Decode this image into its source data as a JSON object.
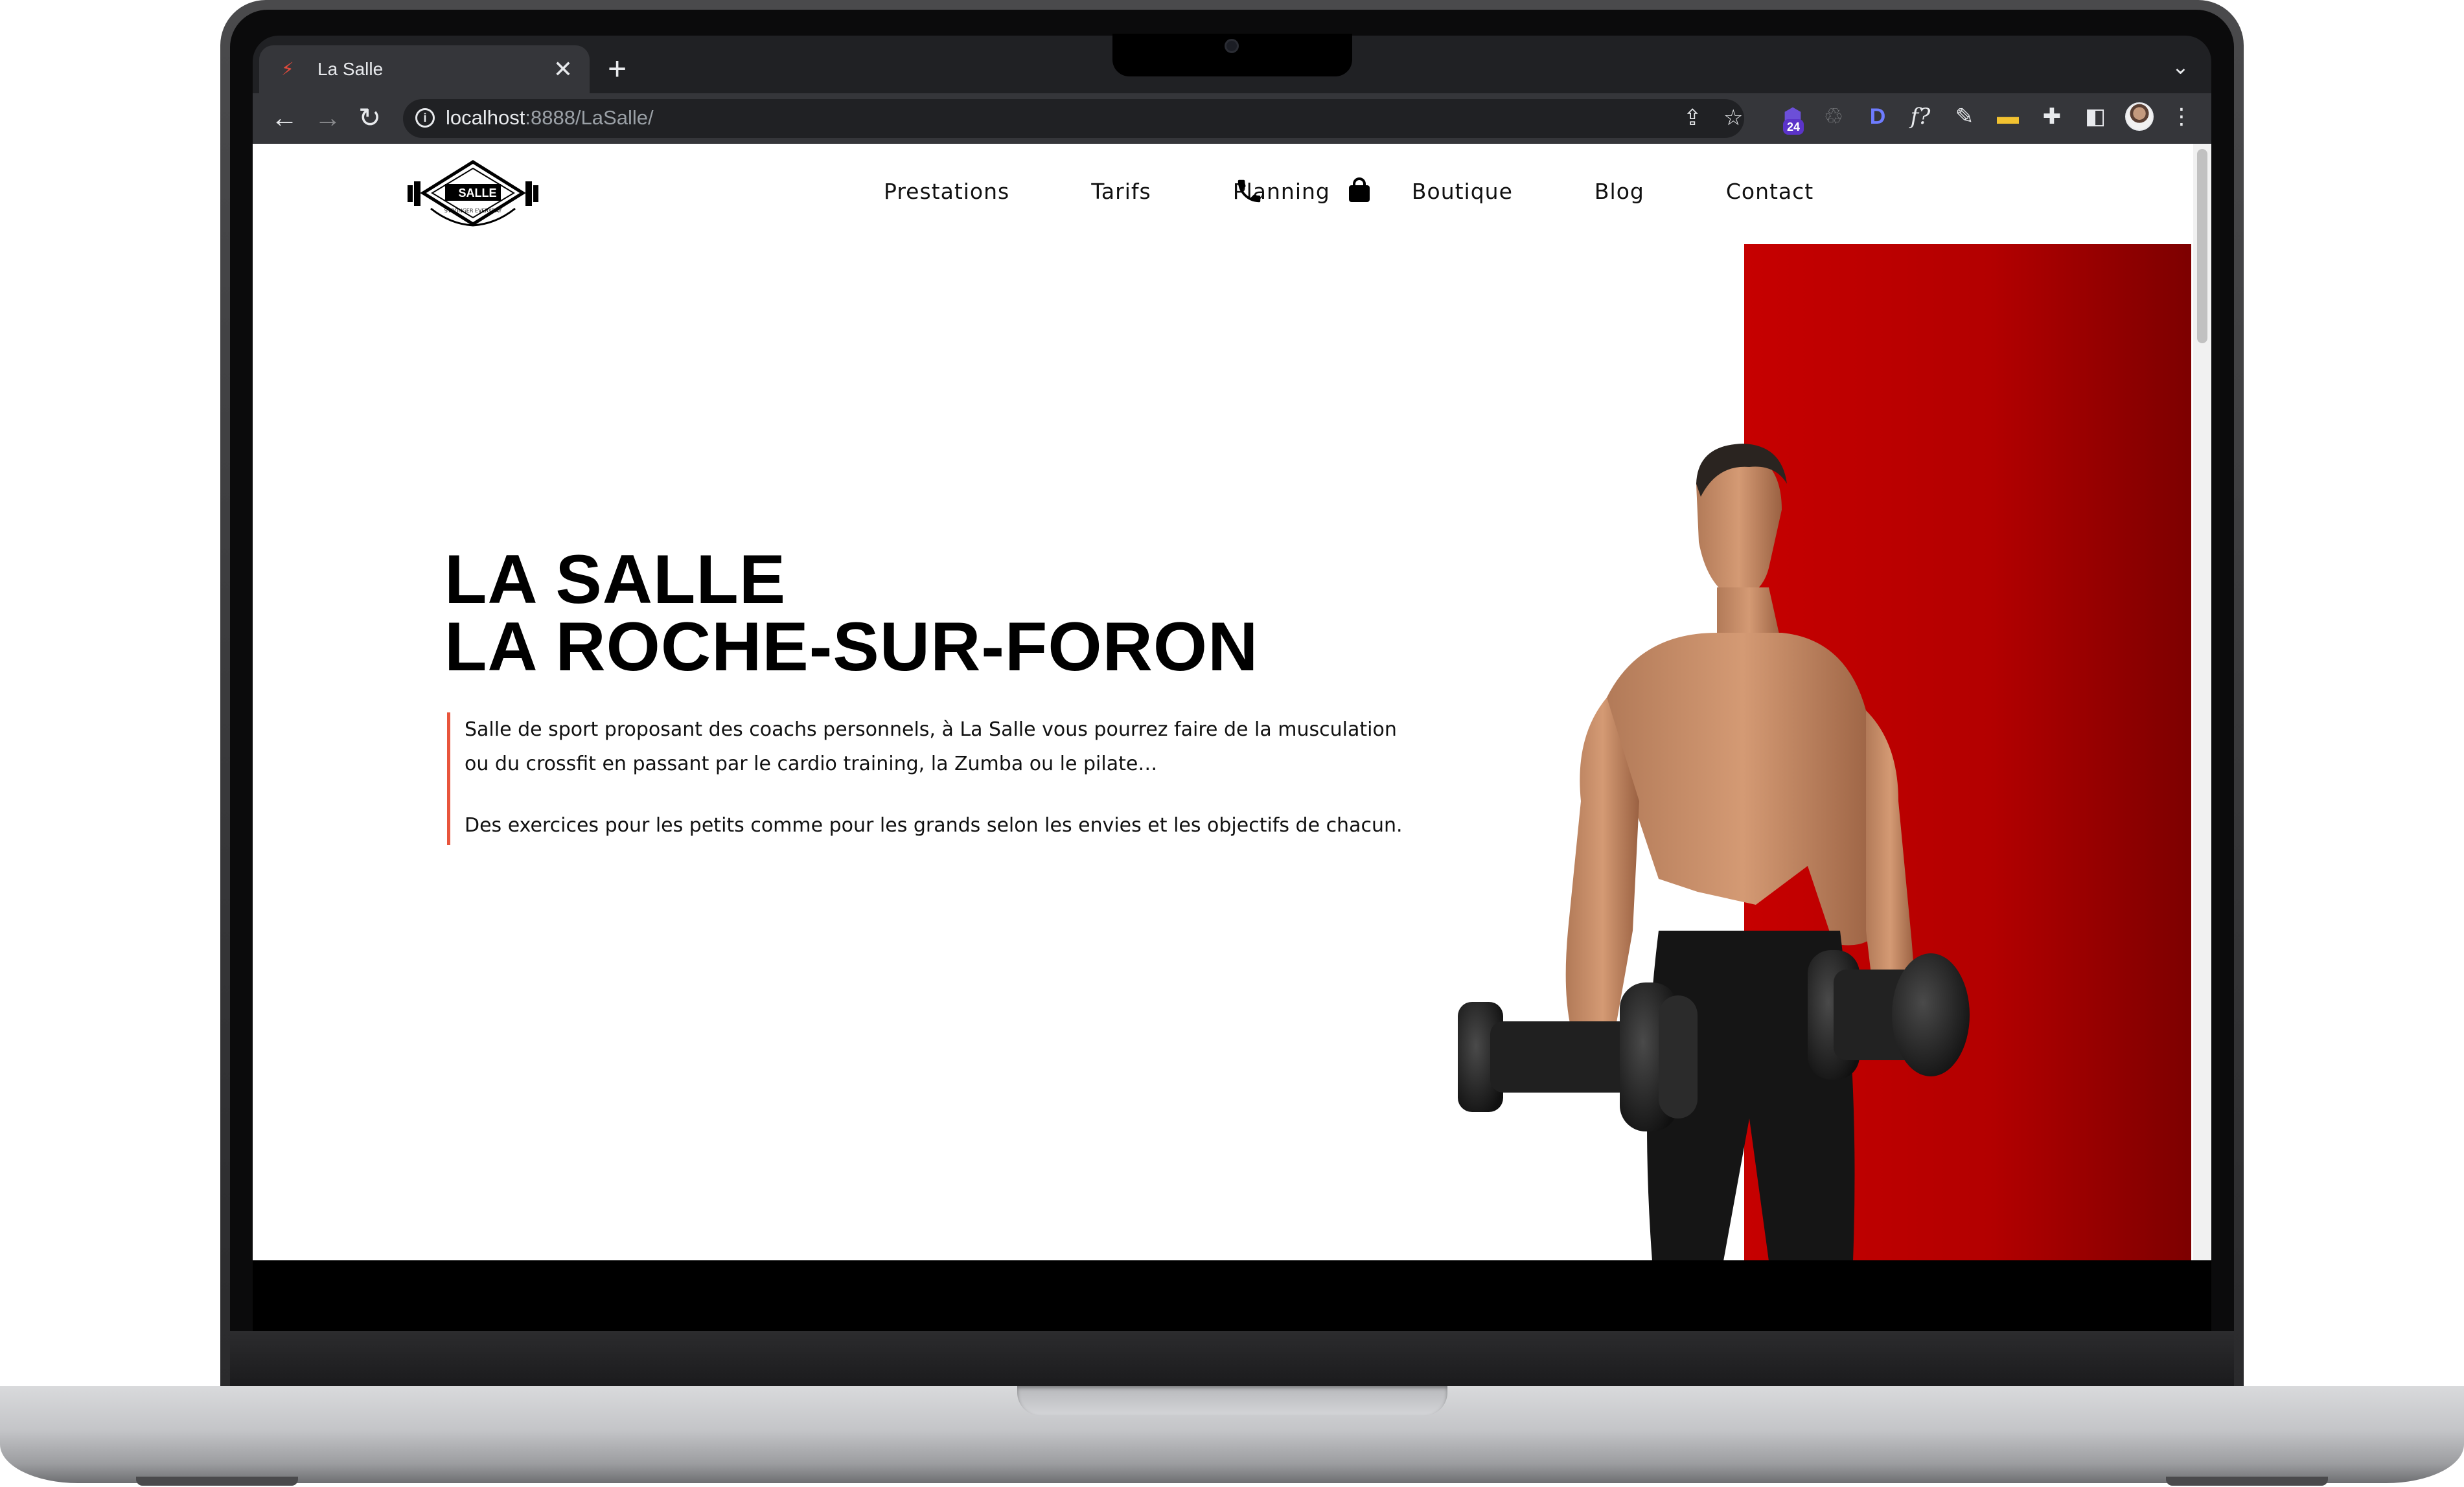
{
  "browser": {
    "tab_title": "La Salle",
    "new_tab_symbol": "+",
    "close_symbol": "✕",
    "url_host": "localhost",
    "url_rest": ":8888/LaSalle/",
    "extension_badge": "24",
    "extensions": [
      "D",
      "f?"
    ]
  },
  "site": {
    "logo_alt": "La Salle logo",
    "logo_wordmark": "SALLE",
    "logo_tagline": "STRONGER EVERYDAY",
    "nav": {
      "items": [
        "Prestations",
        "Tarifs",
        "Planning",
        "Boutique",
        "Blog",
        "Contact"
      ]
    },
    "hero": {
      "title_line1": "LA SALLE",
      "title_line2": "LA ROCHE-SUR-FORON",
      "paragraph1_line1": "Salle de sport proposant des coachs personnels, à La Salle vous pourrez faire de la musculation",
      "paragraph1_line2": "ou du crossfit en passant par le cardio training, la Zumba ou le pilate…",
      "paragraph2": "Des exercices pour les petits comme pour les grands selon les envies et les objectifs de chacun."
    }
  },
  "colors": {
    "accent_red": "#c60000",
    "quote_bar": "#e8553c",
    "text": "#111111"
  },
  "icons": [
    "tab-favicon",
    "back-arrow",
    "forward-arrow",
    "reload",
    "info",
    "share",
    "star",
    "puzzle-icon",
    "side-panel",
    "menu-kebab",
    "phone-icon",
    "shopping-bag-icon"
  ]
}
